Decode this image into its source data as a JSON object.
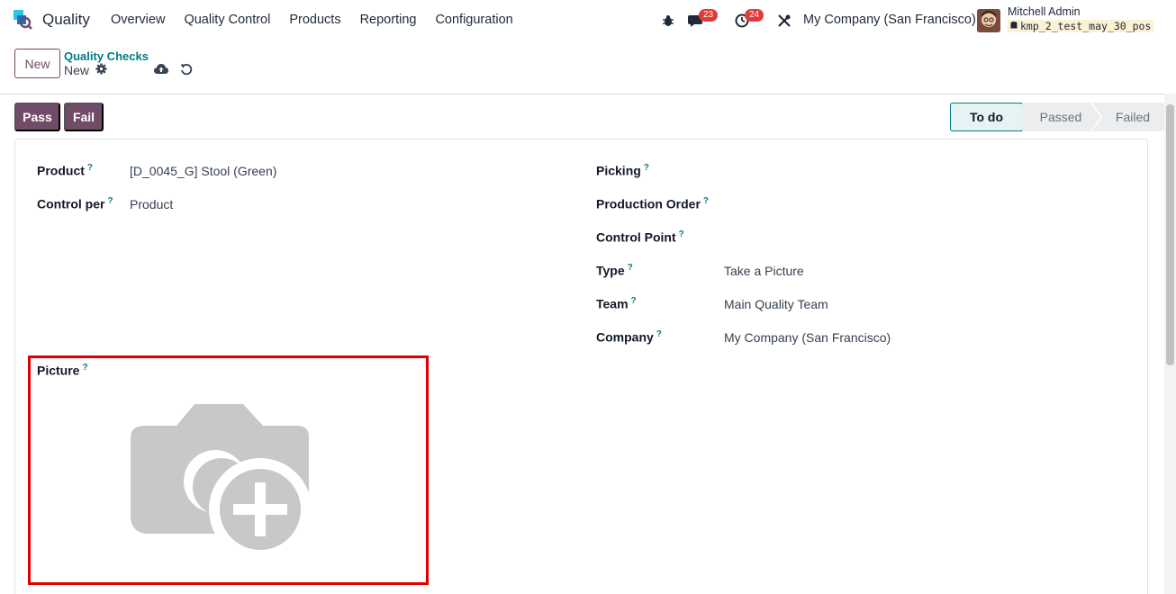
{
  "navbar": {
    "app_name": "Quality",
    "menu": [
      "Overview",
      "Quality Control",
      "Products",
      "Reporting",
      "Configuration"
    ],
    "messages_count": "23",
    "activities_count": "24",
    "company": "My Company (San Francisco)",
    "user_name": "Mitchell Admin",
    "database": "kmp_2_test_may_30_pos"
  },
  "control_panel": {
    "new_label": "New",
    "breadcrumb": "Quality Checks",
    "record_name": "New"
  },
  "actions": {
    "pass_label": "Pass",
    "fail_label": "Fail"
  },
  "statusbar": {
    "stages": [
      "To do",
      "Passed",
      "Failed"
    ],
    "current": "To do"
  },
  "form": {
    "left": [
      {
        "label": "Product",
        "value": "[D_0045_G] Stool (Green)"
      },
      {
        "label": "Control per",
        "value": "Product"
      }
    ],
    "right": [
      {
        "label": "Picking",
        "value": ""
      },
      {
        "label": "Production Order",
        "value": ""
      },
      {
        "label": "Control Point",
        "value": ""
      },
      {
        "label": "Type",
        "value": "Take a Picture"
      },
      {
        "label": "Team",
        "value": "Main Quality Team"
      },
      {
        "label": "Company",
        "value": "My Company (San Francisco)"
      }
    ],
    "picture_label": "Picture",
    "help_mark": "?"
  },
  "colors": {
    "primary": "#714b67",
    "link": "#017e84",
    "highlight": "#e00000"
  }
}
